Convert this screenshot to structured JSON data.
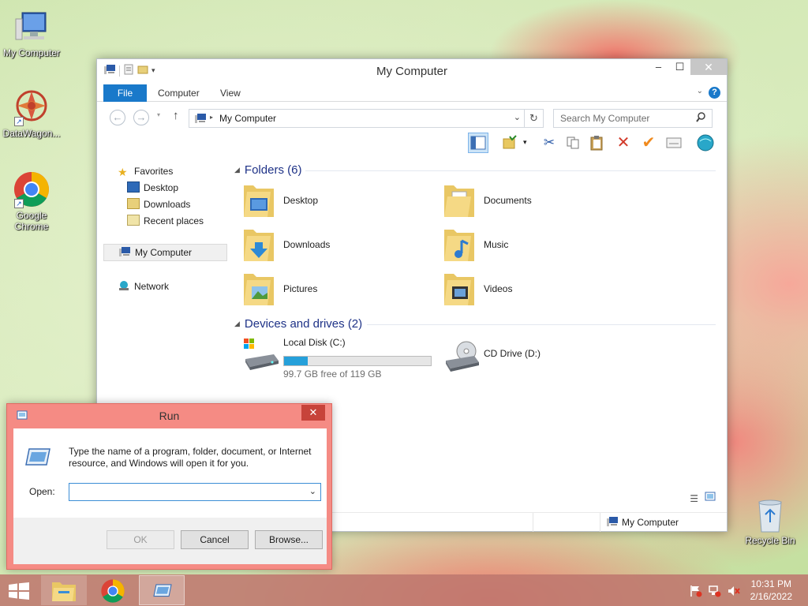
{
  "desktop": {
    "icons": [
      {
        "label": "My Computer",
        "icon": "computer-icon"
      },
      {
        "label": "DataWagon...",
        "icon": "datawagon-icon"
      },
      {
        "label": "Google Chrome",
        "icon": "chrome-icon"
      },
      {
        "label": "Recycle Bin",
        "icon": "recycle-bin-icon"
      }
    ]
  },
  "explorer": {
    "title": "My Computer",
    "tabs": {
      "file": "File",
      "computer": "Computer",
      "view": "View"
    },
    "address": "My Computer",
    "search_placeholder": "Search My Computer",
    "nav": {
      "favorites": "Favorites",
      "desktop": "Desktop",
      "downloads": "Downloads",
      "recent": "Recent places",
      "computer": "My Computer",
      "network": "Network"
    },
    "folders_header": "Folders (6)",
    "folders": [
      {
        "label": "Desktop",
        "icon": "desktop-folder-icon"
      },
      {
        "label": "Documents",
        "icon": "documents-folder-icon"
      },
      {
        "label": "Downloads",
        "icon": "downloads-folder-icon"
      },
      {
        "label": "Music",
        "icon": "music-folder-icon"
      },
      {
        "label": "Pictures",
        "icon": "pictures-folder-icon"
      },
      {
        "label": "Videos",
        "icon": "videos-folder-icon"
      }
    ],
    "devices_header": "Devices and drives (2)",
    "drives": [
      {
        "label": "Local Disk (C:)",
        "free": "99.7 GB free of 119 GB",
        "used_fraction": 0.16
      },
      {
        "label": "CD Drive (D:)"
      }
    ],
    "status_location": "My Computer"
  },
  "run": {
    "title": "Run",
    "description": "Type the name of a program, folder, document, or Internet resource, and Windows will open it for you.",
    "open_label": "Open:",
    "open_value": "",
    "ok": "OK",
    "cancel": "Cancel",
    "browse": "Browse..."
  },
  "taskbar": {
    "time": "10:31 PM",
    "date": "2/16/2022"
  },
  "colors": {
    "accent": "#1979ca",
    "run_frame": "#f58b84",
    "drive_fill": "#26a0da"
  }
}
